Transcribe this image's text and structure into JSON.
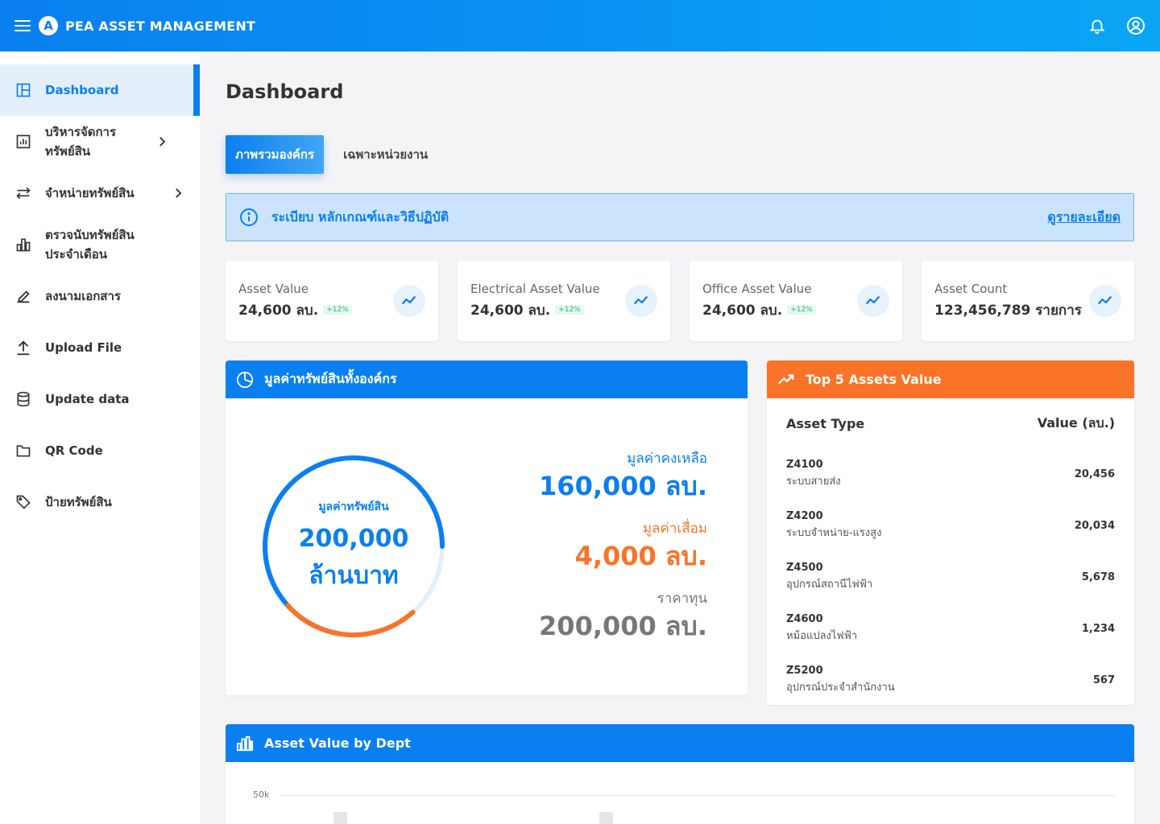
{
  "app": {
    "title": "PEA ASSET MANAGEMENT",
    "logo_letter": "A"
  },
  "topbar": {
    "icons": [
      "menu-icon",
      "bell-icon",
      "user-circle-icon"
    ]
  },
  "sidebar": {
    "items": [
      {
        "label": "Dashboard",
        "icon": "dashboard-icon",
        "active": true
      },
      {
        "label": "บริหารจัดการทรัพย์สิน",
        "icon": "chart-box-icon",
        "has_children": true
      },
      {
        "label": "จำหน่ายทรัพย์สิน",
        "icon": "swap-icon",
        "has_children": true
      },
      {
        "label": "ตรวจนับทรัพย์สินประจำเดือน",
        "icon": "bar-chart-icon"
      },
      {
        "label": "ลงนามเอกสาร",
        "icon": "pen-icon"
      },
      {
        "label": "Upload File",
        "icon": "upload-icon"
      },
      {
        "label": "Update data",
        "icon": "database-icon"
      },
      {
        "label": "QR Code",
        "icon": "folder-icon"
      },
      {
        "label": "ป้ายทรัพย์สิน",
        "icon": "tag-icon"
      }
    ]
  },
  "page": {
    "title": "Dashboard"
  },
  "tabs": [
    {
      "label": "ภาพรวมองค์กร",
      "active": true
    },
    {
      "label": "เฉพาะหน่วยงาน",
      "active": false
    }
  ],
  "banner": {
    "text": "ระเบียบ หลักเกณฑ์และวิธีปฏิบัติ",
    "link": "ดูรายละเอียด"
  },
  "stats": [
    {
      "label": "Asset Value",
      "value": "24,600 ลบ.",
      "badge": "+12%"
    },
    {
      "label": "Electrical Asset Value",
      "value": "24,600 ลบ.",
      "badge": "+12%"
    },
    {
      "label": "Office Asset Value",
      "value": "24,600 ลบ.",
      "badge": "+12%"
    },
    {
      "label": "Asset Count",
      "value": "123,456,789 รายการ",
      "badge": ""
    }
  ],
  "value_panel": {
    "title": "มูลค่าทรัพย์สินทั้งองค์กร",
    "center_label": "มูลค่าทรัพย์สิน",
    "center_value": "200,000",
    "center_unit": "ล้านบาท",
    "donut": {
      "remaining_fraction": 0.8,
      "depreciation_fraction": 0.2
    },
    "remaining_label": "มูลค่าคงเหลือ",
    "remaining_value": "160,000 ลบ.",
    "depreciation_label": "มูลค่าเสื่อม",
    "depreciation_value": "4,000 ลบ.",
    "cost_label": "ราคาทุน",
    "cost_value": "200,000 ลบ.",
    "colors": {
      "remaining": "#0a7ff0",
      "depreciation": "#fa7328",
      "track": "#e3f0fc"
    }
  },
  "top_assets": {
    "title": "Top 5 Assets Value",
    "col_type": "Asset Type",
    "col_value": "Value (ลบ.)",
    "rows": [
      {
        "code": "Z4100",
        "desc": "ระบบสายส่ง",
        "value": "20,456"
      },
      {
        "code": "Z4200",
        "desc": "ระบบจำหน่าย-แรงสูง",
        "value": "20,034"
      },
      {
        "code": "Z4500",
        "desc": "อุปกรณ์สถานีไฟฟ้า",
        "value": "5,678"
      },
      {
        "code": "Z4600",
        "desc": "หม้อแปลงไฟฟ้า",
        "value": "1,234"
      },
      {
        "code": "Z5200",
        "desc": "อุปกรณ์ประจำสำนักงาน",
        "value": "567"
      }
    ]
  },
  "dept_chart": {
    "title": "Asset Value by Dept",
    "chart_data": {
      "type": "bar",
      "title": "Asset Value by Dept",
      "y_ticks": [
        "50k"
      ],
      "grid": true
    }
  },
  "colors": {
    "primary": "#0a7ff0",
    "accent": "#fa7328",
    "badge": "#2bb673"
  }
}
